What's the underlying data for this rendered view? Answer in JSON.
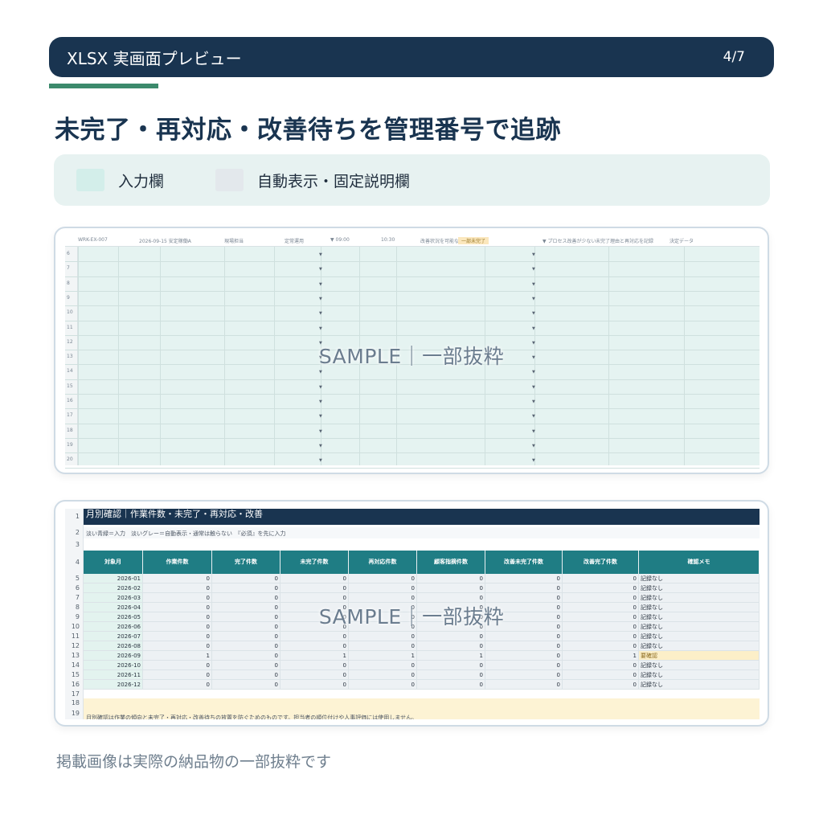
{
  "header": {
    "title": "XLSX 実画面プレビュー",
    "page": "4/7"
  },
  "page_title": "未完了・再対応・改善待ちを管理番号で追跡",
  "legend": {
    "input_label": "入力欄",
    "auto_label": "自動表示・固定説明欄"
  },
  "colors": {
    "header_bg": "#193450",
    "accent": "#3c8a6c",
    "input_fill": "#d3eeea",
    "auto_fill": "#e3e8ec",
    "table_header": "#1f7d84",
    "warn_fill": "#fcefc8"
  },
  "sheet1": {
    "header_cells": [
      "WRK-EX-007",
      "2026-09-15 安定稼働A",
      "現場担当",
      "定常運用",
      "▼ 09:00",
      "10:30",
      "改善状況を可能な範囲を実施",
      "一部未完了",
      "▼ プロセス改善が少ない",
      "未完了理由と再対応を記録",
      "決定データ"
    ],
    "row_numbers": [
      "6",
      "7",
      "8",
      "9",
      "10",
      "11",
      "12",
      "13",
      "14",
      "15",
      "16",
      "17",
      "18",
      "19",
      "20"
    ],
    "watermark": "SAMPLE｜一部抜粋"
  },
  "sheet2": {
    "row_numbers": [
      "1",
      "2",
      "3",
      "4",
      "5",
      "6",
      "7",
      "8",
      "9",
      "10",
      "11",
      "12",
      "13",
      "14",
      "15",
      "16",
      "17",
      "18",
      "19"
    ],
    "title": "月別確認｜作業件数・未完了・再対応・改善",
    "note": "淡い青緑＝入力　淡いグレー＝自動表示・通常は触らない　『必須』を先に入力",
    "columns": [
      "対象月",
      "作業件数",
      "完了件数",
      "未完了件数",
      "再対応件数",
      "顧客指摘件数",
      "改善未完了件数",
      "改善完了件数",
      "確認メモ"
    ],
    "rows": [
      [
        "2026-01",
        "0",
        "0",
        "0",
        "0",
        "0",
        "0",
        "0",
        "記録なし"
      ],
      [
        "2026-02",
        "0",
        "0",
        "0",
        "0",
        "0",
        "0",
        "0",
        "記録なし"
      ],
      [
        "2026-03",
        "0",
        "0",
        "0",
        "0",
        "0",
        "0",
        "0",
        "記録なし"
      ],
      [
        "2026-04",
        "0",
        "0",
        "0",
        "0",
        "0",
        "0",
        "0",
        "記録なし"
      ],
      [
        "2026-05",
        "0",
        "0",
        "0",
        "0",
        "0",
        "0",
        "0",
        "記録なし"
      ],
      [
        "2026-06",
        "0",
        "0",
        "0",
        "0",
        "0",
        "0",
        "0",
        "記録なし"
      ],
      [
        "2026-07",
        "0",
        "0",
        "0",
        "0",
        "0",
        "0",
        "0",
        "記録なし"
      ],
      [
        "2026-08",
        "0",
        "0",
        "0",
        "0",
        "0",
        "0",
        "0",
        "記録なし"
      ],
      [
        "2026-09",
        "1",
        "0",
        "1",
        "1",
        "1",
        "0",
        "1",
        "要確認"
      ],
      [
        "2026-10",
        "0",
        "0",
        "0",
        "0",
        "0",
        "0",
        "0",
        "記録なし"
      ],
      [
        "2026-11",
        "0",
        "0",
        "0",
        "0",
        "0",
        "0",
        "0",
        "記録なし"
      ],
      [
        "2026-12",
        "0",
        "0",
        "0",
        "0",
        "0",
        "0",
        "0",
        "記録なし"
      ]
    ],
    "footer_note": "月別確認は作業の傾向と未完了・再対応・改善待ちの放置を防ぐためのものです。担当者の順位付けや人事評価には使用しません。",
    "watermark": "SAMPLE｜一部抜粋"
  },
  "footnote": "掲載画像は実際の納品物の一部抜粋です"
}
